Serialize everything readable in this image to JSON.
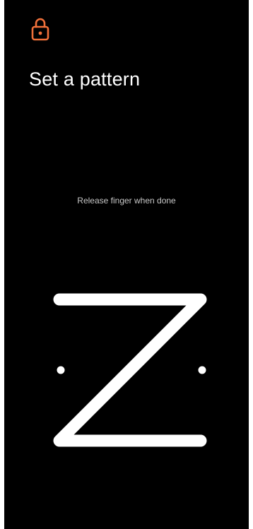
{
  "header": {
    "icon": "lock-icon",
    "title": "Set a pattern"
  },
  "instruction": {
    "text": "Release finger when done"
  },
  "pattern": {
    "drawn_sequence": [
      1,
      2,
      3,
      5,
      7,
      8,
      9
    ],
    "line_color": "#ffffff"
  },
  "colors": {
    "background": "#000000",
    "accent": "#f0703a",
    "text": "#ffffff"
  }
}
